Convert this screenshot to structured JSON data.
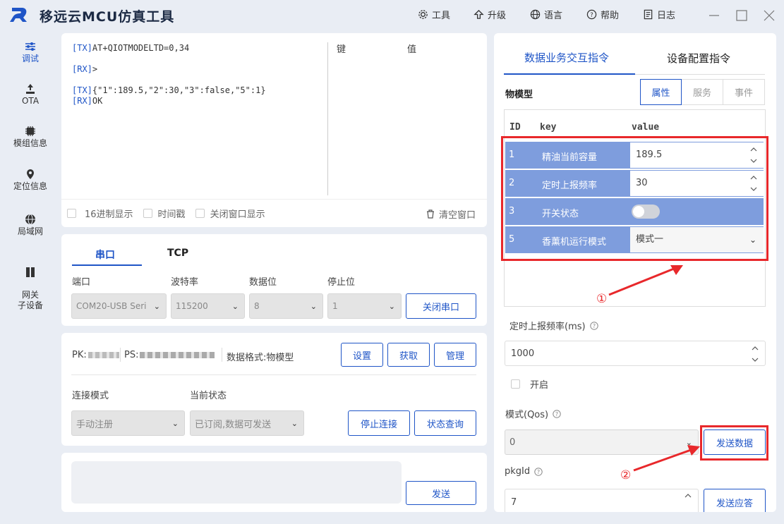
{
  "app": {
    "title": "移远云MCU仿真工具"
  },
  "titlebar": {
    "menu": [
      {
        "label": "工具"
      },
      {
        "label": "升级"
      },
      {
        "label": "语言"
      },
      {
        "label": "帮助"
      },
      {
        "label": "日志"
      }
    ]
  },
  "sidebar": {
    "items": [
      {
        "label": "调试",
        "icon": "sliders-icon"
      },
      {
        "label": "OTA",
        "icon": "upload-icon"
      },
      {
        "label": "模组信息",
        "icon": "chip-icon"
      },
      {
        "label": "定位信息",
        "icon": "location-pin-icon"
      },
      {
        "label": "局域网",
        "icon": "globe-icon"
      },
      {
        "label": "网关\n子设备",
        "icon": "gateway-icon"
      }
    ]
  },
  "log": {
    "lines": [
      {
        "prefix": "[TX]",
        "text": "AT+QIOTMODELTD=0,34"
      },
      {
        "prefix": "[RX]",
        "text": ">"
      },
      {
        "prefix": "[TX]",
        "text": "{\"1\":189.5,\"2\":30,\"3\":false,\"5\":1}"
      },
      {
        "prefix": "[RX]",
        "text": "OK"
      }
    ],
    "kv_headers": {
      "key": "键",
      "value": "值"
    },
    "options": {
      "hex": "16进制显示",
      "timestamp": "时间戳",
      "close_window": "关闭窗口显示"
    },
    "clear": "清空窗口"
  },
  "serial": {
    "tabs": [
      "串口",
      "TCP"
    ],
    "labels": {
      "port": "端口",
      "baud": "波特率",
      "databits": "数据位",
      "stopbits": "停止位"
    },
    "values": {
      "port": "COM20-USB Seri",
      "baud": "115200",
      "databits": "8",
      "stopbits": "1"
    },
    "close_button": "关闭串口"
  },
  "conn": {
    "pk_label": "PK:",
    "ps_label": "PS:",
    "format_label": "数据格式:物模型",
    "buttons": [
      "设置",
      "获取",
      "管理"
    ],
    "mode_label": "连接模式",
    "state_label": "当前状态",
    "mode_value": "手动注册",
    "state_value": "已订阅,数据可发送",
    "stop_button": "停止连接",
    "query_button": "状态查询"
  },
  "send": {
    "button": "发送"
  },
  "right": {
    "tabs": [
      "数据业务交互指令",
      "设备配置指令"
    ],
    "model_label": "物模型",
    "subtabs": [
      "属性",
      "服务",
      "事件"
    ],
    "table_headers": {
      "id": "ID",
      "key": "key",
      "value": "value"
    },
    "rows": [
      {
        "id": "1",
        "key": "精油当前容量",
        "value": "189.5",
        "type": "number"
      },
      {
        "id": "2",
        "key": "定时上报频率",
        "value": "30",
        "type": "number"
      },
      {
        "id": "3",
        "key": "开关状态",
        "value": "false",
        "type": "switch"
      },
      {
        "id": "5",
        "key": "香薰机运行模式",
        "value": "模式一",
        "type": "select"
      }
    ],
    "annot1": "①",
    "annot2": "②",
    "report_label": "定时上报频率(ms)",
    "report_value": "1000",
    "enable_label": "开启",
    "qos_label": "模式(Qos)",
    "qos_value": "0",
    "send_data": "发送数据",
    "pkgid_label": "pkgId",
    "pkgid_value": "7",
    "send_reply": "发送应答"
  },
  "colors": {
    "accent": "#1f55c7",
    "row": "#7e9ddd",
    "annotation": "#e8282b"
  }
}
